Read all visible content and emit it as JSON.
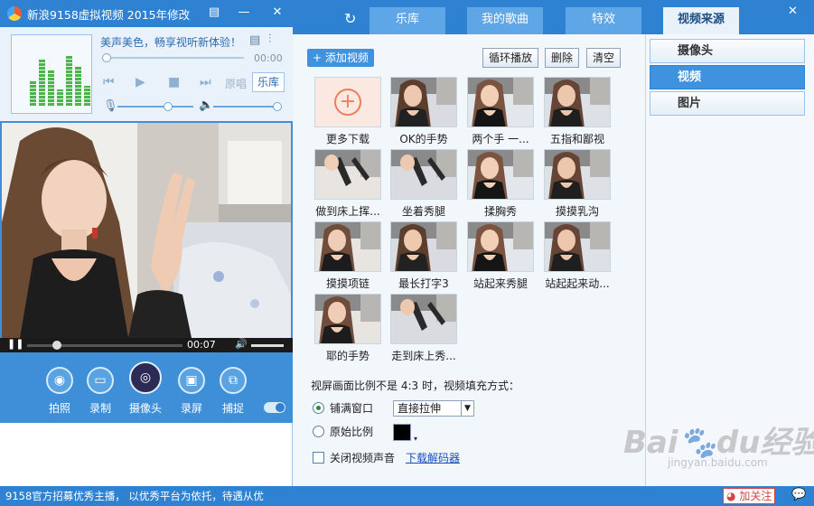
{
  "app": {
    "title": "新浪9158虚拟视频  2015年修改",
    "accent_color": "#2f82d2",
    "highlight_color": "#3f92de"
  },
  "music": {
    "slogan": "美声美色，畅享视听新体验！",
    "time": "00:00",
    "original_label": "原唱",
    "library_label": "乐库"
  },
  "video": {
    "time": "00:07"
  },
  "tools": [
    {
      "label": "拍照",
      "icon": "camera-icon"
    },
    {
      "label": "录制",
      "icon": "video-record-icon"
    },
    {
      "label": "摄像头",
      "icon": "webcam-icon"
    },
    {
      "label": "录屏",
      "icon": "screen-record-icon"
    },
    {
      "label": "捕捉",
      "icon": "capture-icon"
    }
  ],
  "left_status": "9158官方招募优秀主播， 以优秀平台为依托，待遇从优",
  "tabs": [
    {
      "label": "乐库",
      "active": false
    },
    {
      "label": "我的歌曲",
      "active": false
    },
    {
      "label": "特效",
      "active": false
    },
    {
      "label": "视频来源",
      "active": true
    }
  ],
  "toolbar": {
    "add_video": "添加视频",
    "loop_play": "循环播放",
    "delete": "删除",
    "clear": "清空"
  },
  "thumbnails": [
    {
      "caption": "更多下载"
    },
    {
      "caption": "OK的手势"
    },
    {
      "caption": "两个手 一..."
    },
    {
      "caption": "五指和鄙视"
    },
    {
      "caption": "做到床上挥..."
    },
    {
      "caption": "坐着秀腿"
    },
    {
      "caption": "揉胸秀"
    },
    {
      "caption": "摸摸乳沟"
    },
    {
      "caption": "摸摸项链"
    },
    {
      "caption": "最长打字3"
    },
    {
      "caption": "站起来秀腿"
    },
    {
      "caption": "站起起来动..."
    },
    {
      "caption": "耶的手势"
    },
    {
      "caption": "走到床上秀..."
    }
  ],
  "fill_settings": {
    "description": "视屏画面比例不是 4:3 时，视频填充方式：",
    "option_fill": "铺满窗口",
    "stretch_value": "直接拉伸",
    "option_original": "原始比例",
    "mute_label": "关闭视频声音",
    "download_decoder": "下载解码器"
  },
  "sources": [
    {
      "label": "摄像头",
      "active": false
    },
    {
      "label": "视频",
      "active": true
    },
    {
      "label": "图片",
      "active": false
    }
  ],
  "bottom": {
    "follow_label": "加关注"
  },
  "watermark": {
    "logo": "Baidu经验",
    "url": "jingyan.baidu.com"
  }
}
